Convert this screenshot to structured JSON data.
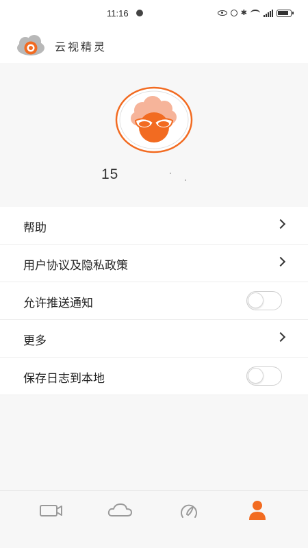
{
  "status_bar": {
    "time": "11:16",
    "icons": [
      "eye-icon",
      "alarm-icon",
      "bluetooth-icon",
      "wifi-icon",
      "signal-5g-icon",
      "battery-icon"
    ]
  },
  "header": {
    "app_name": "云视精灵",
    "logo_icon": "cloud-eye-logo"
  },
  "profile": {
    "phone": "15",
    "avatar_icon": "avatar-with-glasses"
  },
  "menu": {
    "items": [
      {
        "label": "帮助",
        "control": "chevron"
      },
      {
        "label": "用户协议及隐私政策",
        "control": "chevron"
      },
      {
        "label": "允许推送通知",
        "control": "toggle",
        "on": false
      },
      {
        "label": "更多",
        "control": "chevron"
      },
      {
        "label": "保存日志到本地",
        "control": "toggle",
        "on": false
      }
    ]
  },
  "bottom_nav": {
    "tabs": [
      {
        "icon": "video-camera-icon",
        "active": false
      },
      {
        "icon": "cloud-icon",
        "active": false
      },
      {
        "icon": "gauge-icon",
        "active": false
      },
      {
        "icon": "person-icon",
        "active": true
      }
    ]
  },
  "colors": {
    "accent": "#f26b21",
    "inactive_icon": "#9a9a9a",
    "background": "#f7f7f7",
    "card": "#ffffff"
  }
}
